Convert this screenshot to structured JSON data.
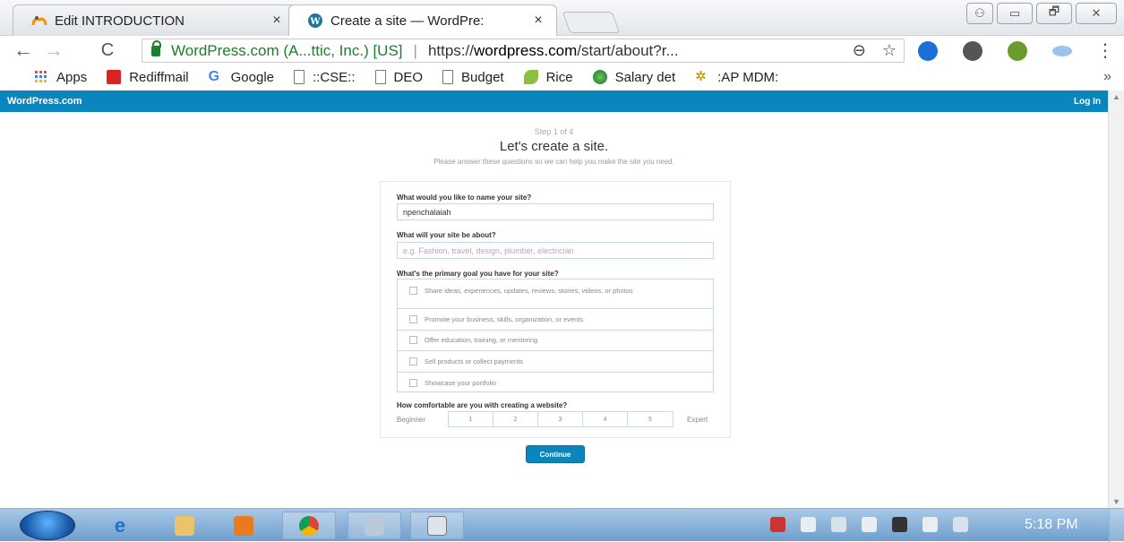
{
  "browser": {
    "tabs": [
      {
        "label": "Edit INTRODUCTION",
        "icon": "moodle-icon",
        "close": "×"
      },
      {
        "label": "Create a site — WordPre:",
        "icon": "wordpress-icon",
        "close": "×"
      }
    ],
    "window_buttons": [
      "⚇",
      "▭",
      "🗗",
      "✕"
    ],
    "nav": {
      "back": "←",
      "forward": "→",
      "reload": "C"
    },
    "address": {
      "site_identity": "WordPress.com (A...ttic, Inc.) [US]",
      "url_prefix": "https://",
      "url_host": "wordpress.com",
      "url_path": "/start/about?r...",
      "zoom_icon": "⊖",
      "star_icon": "☆"
    },
    "menu": "⋮",
    "bookmarks": [
      {
        "label": "Apps",
        "icon": "apps-grid-icon",
        "color": "#e44"
      },
      {
        "label": "Rediffmail",
        "icon": "rediff-icon",
        "color": "#d22"
      },
      {
        "label": "Google",
        "icon": "google-icon",
        "color": "#4285f4"
      },
      {
        "label": "::CSE::",
        "icon": "page-icon",
        "color": "#777"
      },
      {
        "label": "DEO",
        "icon": "page-icon",
        "color": "#777"
      },
      {
        "label": "Budget",
        "icon": "page-icon",
        "color": "#777"
      },
      {
        "label": "Rice",
        "icon": "leaf-icon",
        "color": "#6a3"
      },
      {
        "label": "Salary det",
        "icon": "treasury-icon",
        "color": "#3a6"
      },
      {
        "label": ":AP MDM:",
        "icon": "gear-icon",
        "color": "#b80"
      }
    ],
    "bookmarks_overflow": "»"
  },
  "wp": {
    "brand": "WordPress.com",
    "login": "Log In",
    "step": "Step 1 of 4",
    "headline": "Let's create a site.",
    "subhead": "Please answer these questions so we can help you make the site you need.",
    "q_name": "What would you like to name your site?",
    "name_value": "npenchalaiah",
    "q_about": "What will your site be about?",
    "about_placeholder": "e.g. Fashion, travel, design, plumber, electrician",
    "q_goal": "What's the primary goal you have for your site?",
    "goals": [
      "Share ideas, experiences, updates, reviews, stories, videos, or photos",
      "Promote your business, skills, organization, or events",
      "Offer education, training, or mentoring",
      "Sell products or collect payments",
      "Showcase your portfolio"
    ],
    "q_comfort": "How comfortable are you with creating a website?",
    "scale_low": "Beginner",
    "scale_high": "Expert",
    "scale_options": [
      "1",
      "2",
      "3",
      "4",
      "5"
    ],
    "continue": "Continue",
    "accent": "#0b86bd"
  },
  "taskbar": {
    "clock": "5:18 PM"
  }
}
